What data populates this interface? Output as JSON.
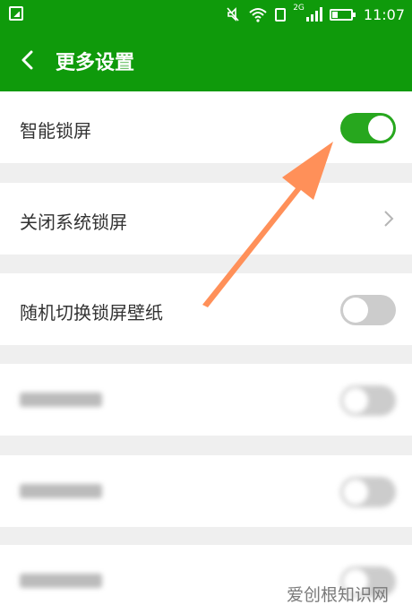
{
  "status_bar": {
    "time": "11:07",
    "network_label": "2G",
    "icons": [
      "image-icon",
      "mute-icon",
      "wifi-icon",
      "sim-icon",
      "signal-icon",
      "battery-icon"
    ]
  },
  "header": {
    "title": "更多设置",
    "back_icon": "chevron-left-icon"
  },
  "settings": [
    {
      "label": "智能锁屏",
      "control": "toggle",
      "state": "on"
    },
    {
      "label": "关闭系统锁屏",
      "control": "chevron"
    },
    {
      "label": "随机切换锁屏壁纸",
      "control": "toggle",
      "state": "off"
    },
    {
      "label": "",
      "control": "toggle",
      "state": "off",
      "blurred": true
    },
    {
      "label": "",
      "control": "toggle",
      "state": "off",
      "blurred": true
    },
    {
      "label": "",
      "control": "toggle",
      "state": "off",
      "blurred": true
    }
  ],
  "annotation": {
    "type": "arrow",
    "color": "#ff8a50"
  },
  "watermark": "爱创根知识网",
  "colors": {
    "header_green": "#0f9a0b",
    "toggle_on": "#27a71e",
    "toggle_off": "#cccccc",
    "background": "#efefef"
  }
}
